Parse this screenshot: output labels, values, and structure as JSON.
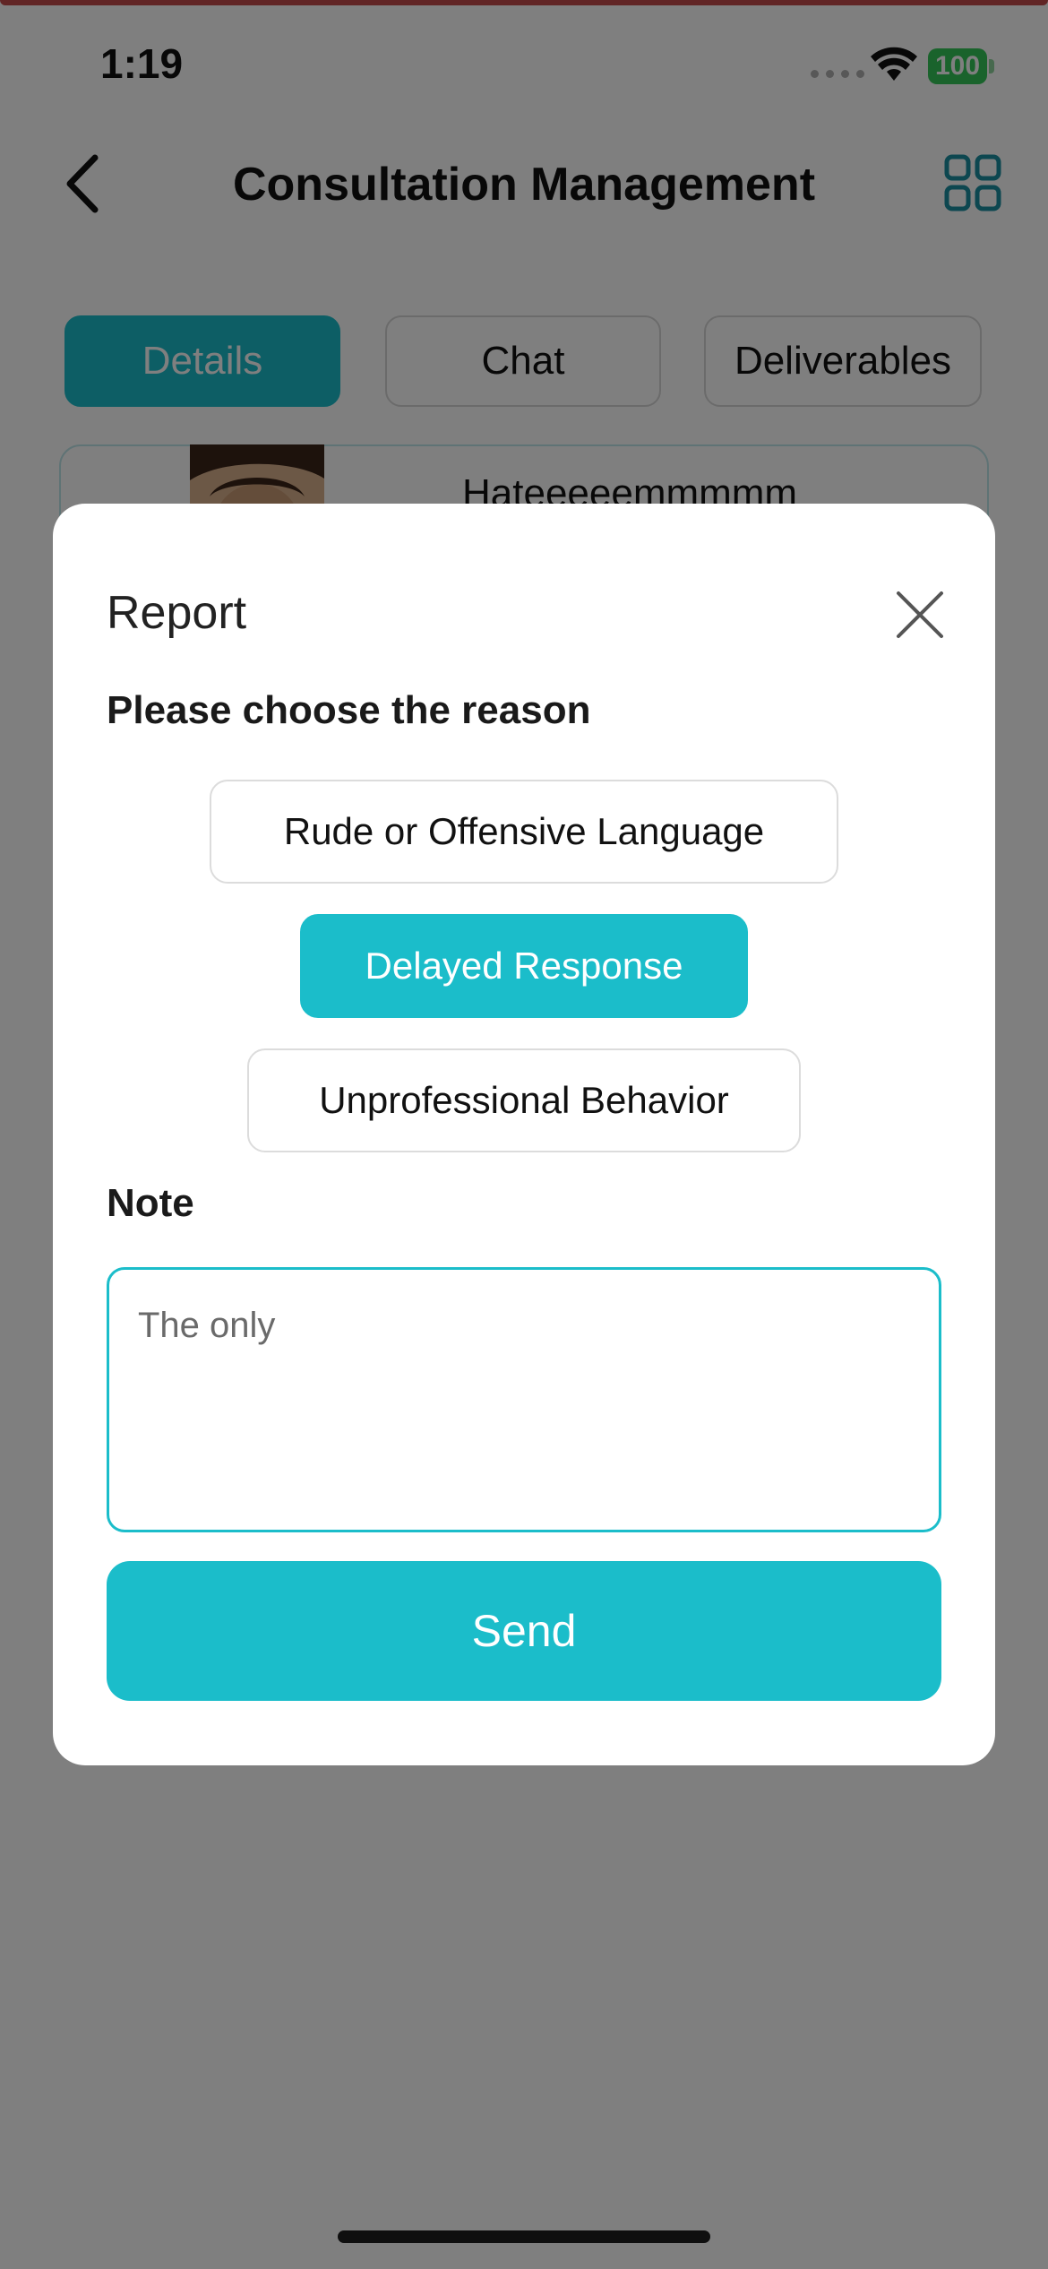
{
  "status_bar": {
    "time": "1:19",
    "battery": "100"
  },
  "header": {
    "title": "Consultation Management"
  },
  "tabs": [
    {
      "label": "Details",
      "active": true
    },
    {
      "label": "Chat",
      "active": false
    },
    {
      "label": "Deliverables",
      "active": false
    }
  ],
  "card": {
    "name": "Hateeeeemmmmm"
  },
  "modal": {
    "title": "Report",
    "reason_label": "Please choose the reason",
    "options": [
      {
        "label": "Rude or Offensive Language",
        "selected": false
      },
      {
        "label": "Delayed Response",
        "selected": true
      },
      {
        "label": "Unprofessional Behavior",
        "selected": false
      }
    ],
    "note_label": "Note",
    "note_value": "The only",
    "send_label": "Send"
  },
  "colors": {
    "accent": "#1bbdca",
    "overlay": "rgba(0,0,0,0.5)"
  },
  "icons": {
    "back": "chevron-left-icon",
    "grid": "grid-icon",
    "close": "close-icon",
    "wifi": "wifi-icon"
  }
}
